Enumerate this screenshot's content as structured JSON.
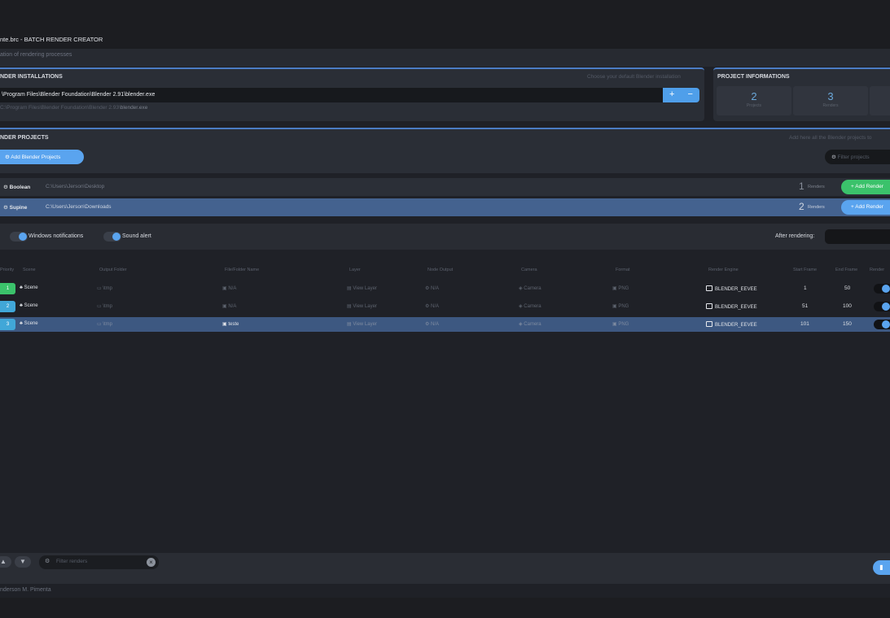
{
  "window": {
    "title": "nte.brc - BATCH RENDER CREATOR",
    "subtitle": "ation of rendering processes"
  },
  "installations": {
    "title": "NDER INSTALLATIONS",
    "hint": "Choose your default Blender installation",
    "path": "\\Program Files\\Blender Foundation\\Blender 2.91\\blender.exe",
    "add_label": "+",
    "remove_label": "−",
    "alt_prefix": "C:\\Program Files\\Blender Foundation\\Blender 2.93\\",
    "alt_exe": "blender.exe"
  },
  "project_info": {
    "title": "PROJECT INFORMATIONS",
    "stats": [
      {
        "value": "2",
        "label": "Projects"
      },
      {
        "value": "3",
        "label": "Renders"
      }
    ]
  },
  "projects": {
    "title": "NDER PROJECTS",
    "hint": "Add here all the Blender projects to",
    "add_label": "Add Blender Projects",
    "filter_placeholder": "Filter projects",
    "items": [
      {
        "name": "Boolean",
        "path": "C:\\Users\\Jerson\\Desktop",
        "count": "1",
        "count_label": "Renders",
        "add_label": "Add Render"
      },
      {
        "name": "Supine",
        "path": "C:\\Users\\Jerson\\Downloads",
        "count": "2",
        "count_label": "Renders",
        "add_label": "Add Render"
      }
    ]
  },
  "options": {
    "windows_notifications": "Windows notifications",
    "sound_alert": "Sound alert",
    "after_rendering": "After rendering:"
  },
  "renders": {
    "headers": [
      "Priority",
      "Scene",
      "Output Folder",
      "File/Folder Name",
      "Layer",
      "Node Output",
      "Camera",
      "Format",
      "Render Engine",
      "Start Frame",
      "End Frame",
      "Render"
    ],
    "rows": [
      {
        "priority": "1",
        "scene": "Scene",
        "output": "\\tmp",
        "file": "N/A",
        "layer": "View Layer",
        "node": "N/A",
        "camera": "Camera",
        "format": "PNG",
        "engine": "BLENDER_EEVEE",
        "start": "1",
        "end": "50"
      },
      {
        "priority": "2",
        "scene": "Scene",
        "output": "\\tmp",
        "file": "N/A",
        "layer": "View Layer",
        "node": "N/A",
        "camera": "Camera",
        "format": "PNG",
        "engine": "BLENDER_EEVEE",
        "start": "51",
        "end": "100"
      },
      {
        "priority": "3",
        "scene": "Scene",
        "output": "\\tmp",
        "file": "teste",
        "layer": "View Layer",
        "node": "N/A",
        "camera": "Camera",
        "format": "PNG",
        "engine": "BLENDER_EEVEE",
        "start": "101",
        "end": "150"
      }
    ]
  },
  "footer": {
    "up_label": "▲",
    "down_label": "▼",
    "filter_placeholder": "Filter renders",
    "clear_label": "×",
    "author": "nderson M. Pimenta"
  },
  "colors": {
    "accent": "#5aa4ef",
    "green": "#3bc26b",
    "blue_badge": "#41a7d8",
    "selection": "#3d5881"
  }
}
